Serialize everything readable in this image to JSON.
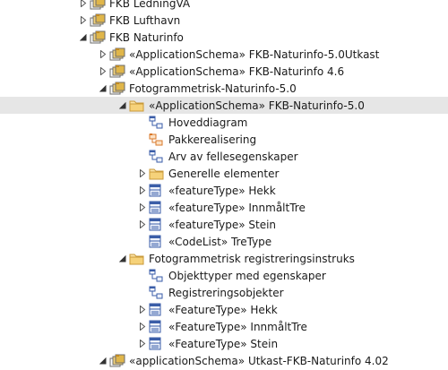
{
  "tree": [
    {
      "label": "FKB LedningVA",
      "expander": "collapsed",
      "icon": "package-stack-icon",
      "depth": 0
    },
    {
      "label": "FKB Lufthavn",
      "expander": "collapsed",
      "icon": "package-stack-icon",
      "depth": 0
    },
    {
      "label": "FKB Naturinfo",
      "expander": "expanded",
      "icon": "package-stack-icon",
      "depth": 0
    },
    {
      "label": "«ApplicationSchema» FKB-Naturinfo-5.0Utkast",
      "expander": "collapsed",
      "icon": "package-stack-icon",
      "depth": 1
    },
    {
      "label": "«ApplicationSchema» FKB-Naturinfo 4.6",
      "expander": "collapsed",
      "icon": "package-stack-icon",
      "depth": 1
    },
    {
      "label": "Fotogrammetrisk-Naturinfo-5.0",
      "expander": "expanded",
      "icon": "package-stack-icon",
      "depth": 1
    },
    {
      "label": "«ApplicationSchema» FKB-Naturinfo-5.0",
      "expander": "expanded",
      "icon": "folder-icon",
      "depth": 2,
      "selected": true
    },
    {
      "label": "Hoveddiagram",
      "expander": "none",
      "icon": "class-diagram-icon",
      "depth": 3
    },
    {
      "label": "Pakkerealisering",
      "expander": "none",
      "icon": "package-diagram-icon",
      "depth": 3
    },
    {
      "label": "Arv av fellesegenskaper",
      "expander": "none",
      "icon": "class-diagram-icon",
      "depth": 3
    },
    {
      "label": "Generelle elementer",
      "expander": "collapsed",
      "icon": "folder-icon",
      "depth": 3
    },
    {
      "label": "«featureType» Hekk",
      "expander": "collapsed",
      "icon": "class-icon",
      "depth": 3
    },
    {
      "label": "«featureType» InnmåltTre",
      "expander": "collapsed",
      "icon": "class-icon",
      "depth": 3
    },
    {
      "label": "«featureType» Stein",
      "expander": "collapsed",
      "icon": "class-icon",
      "depth": 3
    },
    {
      "label": "«CodeList» TreType",
      "expander": "none",
      "icon": "class-icon",
      "depth": 3
    },
    {
      "label": "Fotogrammetrisk registreringsinstruks",
      "expander": "expanded",
      "icon": "folder-icon",
      "depth": 2
    },
    {
      "label": "Objekttyper med egenskaper",
      "expander": "none",
      "icon": "class-diagram-icon",
      "depth": 3
    },
    {
      "label": "Registreringsobjekter",
      "expander": "none",
      "icon": "class-diagram-icon",
      "depth": 3
    },
    {
      "label": "«FeatureType» Hekk",
      "expander": "collapsed",
      "icon": "class-icon",
      "depth": 3
    },
    {
      "label": "«FeatureType» InnmåltTre",
      "expander": "collapsed",
      "icon": "class-icon",
      "depth": 3
    },
    {
      "label": "«FeatureType» Stein",
      "expander": "collapsed",
      "icon": "class-icon",
      "depth": 3
    },
    {
      "label": "«applicationSchema» Utkast-FKB-Naturinfo 4.02",
      "expander": "expanded",
      "icon": "package-stack-icon",
      "depth": 1
    }
  ],
  "colors": {
    "selection": "#e6e6e6",
    "folder": "#d9a441",
    "package": "#e0b64a",
    "class_blue": "#3b5ea8",
    "diagram_orange": "#d9792b",
    "expander": "#555555"
  }
}
